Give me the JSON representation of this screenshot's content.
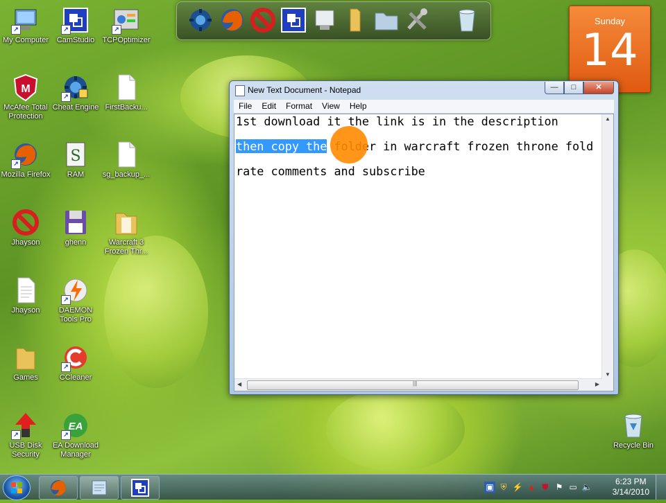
{
  "desktop": {
    "icons": [
      {
        "label": "My Computer",
        "icon": "computer-icon"
      },
      {
        "label": "CamStudio",
        "icon": "camstudio-icon"
      },
      {
        "label": "TCPOptimizer",
        "icon": "tcpoptimizer-icon"
      },
      {
        "label": "McAfee Total Protection",
        "icon": "mcafee-icon"
      },
      {
        "label": "Cheat Engine",
        "icon": "cheat-engine-icon"
      },
      {
        "label": "FirstBacku...",
        "icon": "document-icon"
      },
      {
        "label": "Mozilla Firefox",
        "icon": "firefox-icon"
      },
      {
        "label": "RAM",
        "icon": "ram-icon"
      },
      {
        "label": "sg_backup_...",
        "icon": "document-icon"
      },
      {
        "label": "Jhayson",
        "icon": "no-sign-icon"
      },
      {
        "label": "ghenn",
        "icon": "floppy-icon"
      },
      {
        "label": "Warcraft 3 Frozen Thr...",
        "icon": "folder-icon"
      },
      {
        "label": "Jhayson",
        "icon": "document-icon"
      },
      {
        "label": "DAEMON Tools Pro",
        "icon": "daemon-tools-icon"
      },
      {
        "label": "Games",
        "icon": "folder-icon"
      },
      {
        "label": "CCleaner",
        "icon": "ccleaner-icon"
      },
      {
        "label": "USB Disk Security",
        "icon": "usb-disk-security-icon"
      },
      {
        "label": "EA Download Manager",
        "icon": "ea-icon"
      },
      {
        "label": "Recycle Bin",
        "icon": "recycle-bin-icon"
      }
    ]
  },
  "dock": {
    "items": [
      "cheat-engine-icon",
      "firefox-icon",
      "no-sign-icon",
      "camstudio-icon",
      "notepad-icon",
      "folder-icon",
      "folder-open-icon",
      "tools-icon",
      "recycle-bin-icon"
    ]
  },
  "calendar": {
    "day": "Sunday",
    "date": "14"
  },
  "notepad": {
    "title": "New Text Document - Notepad",
    "menu": [
      "File",
      "Edit",
      "Format",
      "View",
      "Help"
    ],
    "lines": {
      "l1": "1st download it the link is in the description",
      "l2_selected": "then copy the",
      "l2_rest": " folder in warcraft frozen throne fold",
      "l3": "rate comments and subscribe"
    },
    "hscroll_grip": "|||"
  },
  "window_buttons": {
    "minimize": "—",
    "maximize": "□",
    "close": "✕"
  },
  "taskbar": {
    "buttons": [
      "firefox-icon",
      "notepad-icon",
      "camstudio-icon"
    ],
    "tray": [
      "network-icon",
      "shield-icon",
      "daemon-icon",
      "usb-icon",
      "mcafee-icon",
      "flag-icon",
      "display-icon",
      "volume-icon"
    ],
    "time": "6:23 PM",
    "date": "3/14/2010"
  }
}
